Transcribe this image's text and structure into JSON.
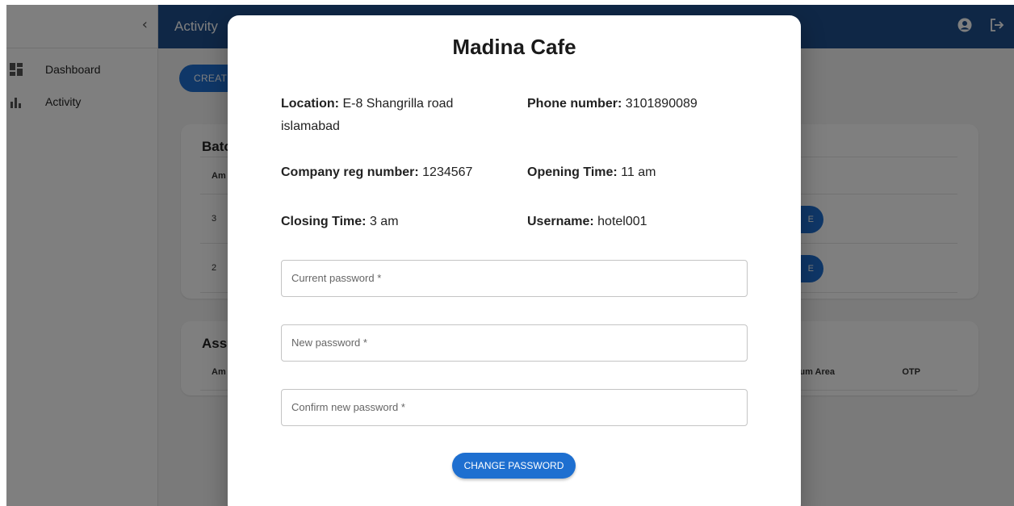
{
  "appbar": {
    "title": "Activity"
  },
  "sidebar": {
    "items": [
      {
        "label": "Dashboard",
        "icon": "dashboard-icon"
      },
      {
        "label": "Activity",
        "icon": "bar-chart-icon"
      }
    ]
  },
  "main": {
    "create_button": "CREAT",
    "batch_card": {
      "title": "Batc",
      "header_first": "Am",
      "rows": [
        {
          "first": "3",
          "button": "E"
        },
        {
          "first": "2",
          "button": "E"
        }
      ]
    },
    "assigned_card": {
      "title": "Ass",
      "header_first": "Am",
      "header_area": "um Area",
      "header_otp": "OTP"
    }
  },
  "modal": {
    "title": "Madina Cafe",
    "location": {
      "label": "Location:",
      "value": "E-8 Shangrilla road islamabad"
    },
    "phone": {
      "label": "Phone number:",
      "value": "3101890089"
    },
    "company_reg": {
      "label": "Company reg number:",
      "value": "1234567"
    },
    "opening_time": {
      "label": "Opening Time:",
      "value": "11 am"
    },
    "closing_time": {
      "label": "Closing Time:",
      "value": "3 am"
    },
    "username": {
      "label": "Username:",
      "value": "hotel001"
    },
    "current_password": {
      "placeholder": "Current password *",
      "value": ""
    },
    "new_password": {
      "placeholder": "New password *",
      "value": ""
    },
    "confirm_password": {
      "placeholder": "Confirm new password *",
      "value": ""
    },
    "submit_label": "CHANGE PASSWORD"
  },
  "colors": {
    "primary": "#1e6fd0",
    "appbar": "#1e4f8c"
  }
}
